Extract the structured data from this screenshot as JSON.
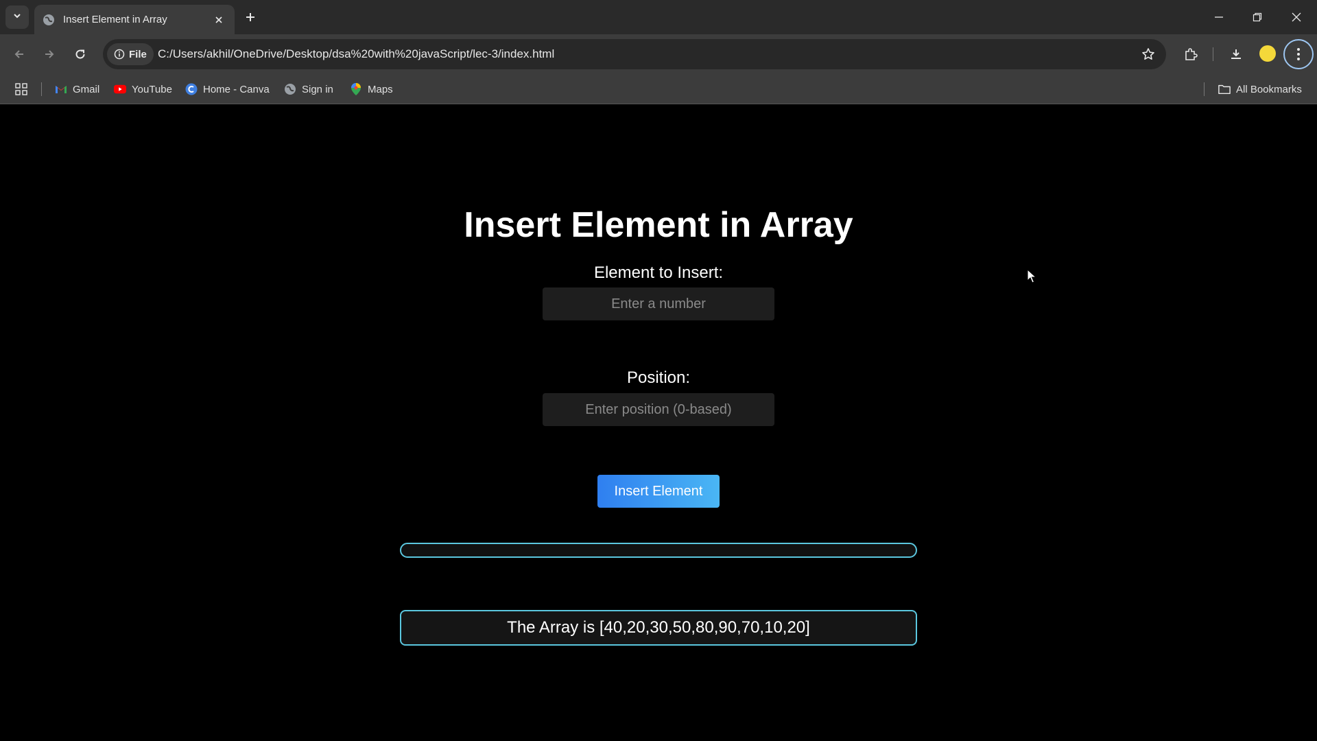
{
  "browser": {
    "tab_title": "Insert Element in Array",
    "url_scheme_label": "File",
    "url": "C:/Users/akhil/OneDrive/Desktop/dsa%20with%20javaScript/lec-3/index.html",
    "bookmarks": [
      {
        "label": "Gmail",
        "icon": "gmail-icon"
      },
      {
        "label": "YouTube",
        "icon": "youtube-icon"
      },
      {
        "label": "Home - Canva",
        "icon": "canva-icon"
      },
      {
        "label": "Sign in",
        "icon": "globe-icon"
      },
      {
        "label": "Maps",
        "icon": "maps-pin-icon"
      }
    ],
    "all_bookmarks_label": "All Bookmarks"
  },
  "page": {
    "title": "Insert Element in Array",
    "element_label": "Element to Insert:",
    "element_placeholder": "Enter a number",
    "element_value": "",
    "position_label": "Position:",
    "position_placeholder": "Enter position (0-based)",
    "position_value": "",
    "insert_button_label": "Insert Element",
    "result_text": "",
    "array_text": "The Array is [40,20,30,50,80,90,70,10,20]"
  },
  "colors": {
    "accent_gradient_start": "#2f7ff0",
    "accent_gradient_end": "#4ab6f4",
    "box_border": "#5bc7df",
    "background": "#000000"
  }
}
